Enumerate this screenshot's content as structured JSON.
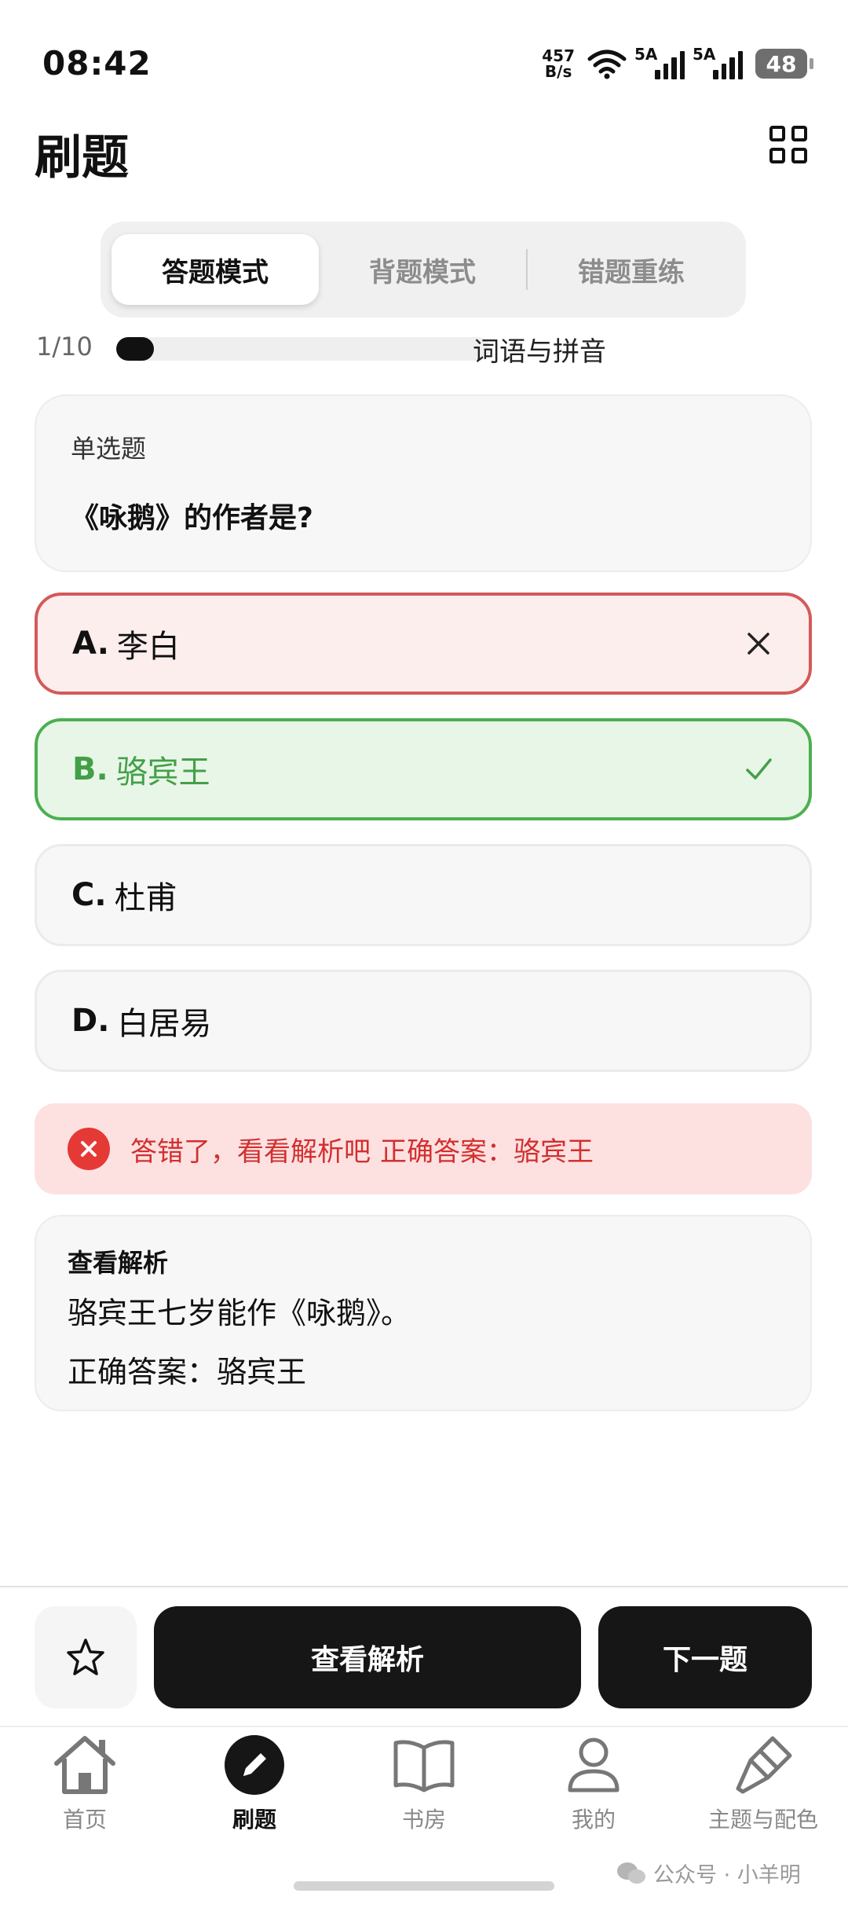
{
  "status_bar": {
    "time": "08:42",
    "net_speed": "457",
    "net_unit": "B/s",
    "signal1": "5A",
    "signal2": "5A",
    "battery": "48"
  },
  "header": {
    "title": "刷题"
  },
  "tabs": [
    {
      "label": "答题模式",
      "active": true
    },
    {
      "label": "背题模式"
    },
    {
      "label": "错题重练"
    }
  ],
  "progress": {
    "text": "1/10",
    "current": 1,
    "total": 10,
    "category": "词语与拼音"
  },
  "question": {
    "type": "单选题",
    "text": "《咏鹅》的作者是?"
  },
  "options": [
    {
      "letter": "A.",
      "text": "李白",
      "state": "wrong"
    },
    {
      "letter": "B.",
      "text": "骆宾王",
      "state": "correct"
    },
    {
      "letter": "C.",
      "text": "杜甫"
    },
    {
      "letter": "D.",
      "text": "白居易"
    }
  ],
  "feedback": {
    "message": "答错了，看看解析吧",
    "answer": "正确答案：骆宾王"
  },
  "analysis": {
    "title": "查看解析",
    "body": "骆宾王七岁能作《咏鹅》。",
    "answer": "正确答案：骆宾王"
  },
  "actions": {
    "analysis_label": "查看解析",
    "next_label": "下一题"
  },
  "nav": [
    {
      "label": "首页"
    },
    {
      "label": "刷题",
      "active": true
    },
    {
      "label": "书房"
    },
    {
      "label": "我的"
    },
    {
      "label": "主题与配色"
    }
  ],
  "watermark": "公众号 · 小羊明",
  "colors": {
    "wrong": "#d35a5a",
    "correct": "#4caf50",
    "error_bg": "#fde1e1",
    "dark": "#161616"
  }
}
